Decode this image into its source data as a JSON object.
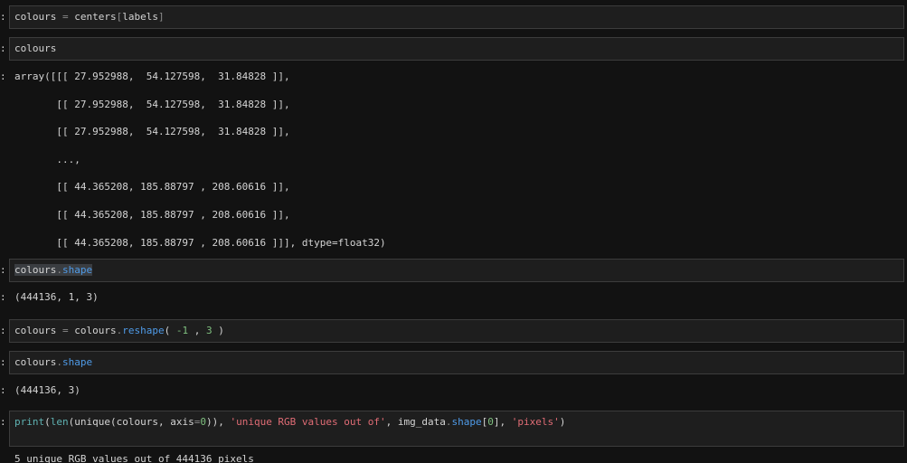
{
  "cells": [
    {
      "prompt": ":",
      "tokens": [
        {
          "t": "colours ",
          "c": "tok-kw"
        },
        {
          "t": "=",
          "c": "tok-op"
        },
        {
          "t": " centers",
          "c": "tok-kw"
        },
        {
          "t": "[",
          "c": "tok-op"
        },
        {
          "t": "labels",
          "c": "tok-kw"
        },
        {
          "t": "]",
          "c": "tok-op"
        }
      ]
    },
    {
      "prompt": ":",
      "tokens": [
        {
          "t": "colours",
          "c": "tok-kw"
        }
      ]
    },
    {
      "prompt": ":",
      "tokens": [
        {
          "t": "colours",
          "c": "tok-kw sel"
        },
        {
          "t": ".",
          "c": "tok-op sel"
        },
        {
          "t": "shape",
          "c": "tok-attr sel"
        }
      ]
    },
    {
      "prompt": ":",
      "tokens": [
        {
          "t": "colours ",
          "c": "tok-kw"
        },
        {
          "t": "=",
          "c": "tok-op"
        },
        {
          "t": " colours",
          "c": "tok-kw"
        },
        {
          "t": ".",
          "c": "tok-op"
        },
        {
          "t": "reshape",
          "c": "tok-attr"
        },
        {
          "t": "( ",
          "c": "tok-kw"
        },
        {
          "t": "-1",
          "c": "tok-num"
        },
        {
          "t": " , ",
          "c": "tok-kw"
        },
        {
          "t": "3",
          "c": "tok-num"
        },
        {
          "t": " )",
          "c": "tok-kw"
        }
      ]
    },
    {
      "prompt": ":",
      "tokens": [
        {
          "t": "colours",
          "c": "tok-kw"
        },
        {
          "t": ".",
          "c": "tok-op"
        },
        {
          "t": "shape",
          "c": "tok-attr"
        }
      ]
    },
    {
      "prompt": ":",
      "tokens": [
        {
          "t": "print",
          "c": "tok-fn"
        },
        {
          "t": "(",
          "c": "tok-kw"
        },
        {
          "t": "len",
          "c": "tok-fn"
        },
        {
          "t": "(unique(colours, axis",
          "c": "tok-kw"
        },
        {
          "t": "=",
          "c": "tok-op"
        },
        {
          "t": "0",
          "c": "tok-num"
        },
        {
          "t": ")), ",
          "c": "tok-kw"
        },
        {
          "t": "'unique RGB values out of'",
          "c": "tok-str"
        },
        {
          "t": ", img_data",
          "c": "tok-kw"
        },
        {
          "t": ".",
          "c": "tok-op"
        },
        {
          "t": "shape",
          "c": "tok-attr"
        },
        {
          "t": "[",
          "c": "tok-kw"
        },
        {
          "t": "0",
          "c": "tok-num"
        },
        {
          "t": "], ",
          "c": "tok-kw"
        },
        {
          "t": "'pixels'",
          "c": "tok-str"
        },
        {
          "t": ")",
          "c": "tok-kw"
        }
      ]
    }
  ],
  "outputs": {
    "colours_array": {
      "prompt": ":",
      "lines": [
        "array([[[ 27.952988,  54.127598,  31.84828 ]],",
        "       [[ 27.952988,  54.127598,  31.84828 ]],",
        "       [[ 27.952988,  54.127598,  31.84828 ]],",
        "       ...,",
        "       [[ 44.365208, 185.88797 , 208.60616 ]],",
        "       [[ 44.365208, 185.88797 , 208.60616 ]],",
        "       [[ 44.365208, 185.88797 , 208.60616 ]]], dtype=float32)"
      ]
    },
    "shape_before": {
      "prompt": ":",
      "text": "(444136, 1, 3)"
    },
    "shape_after": {
      "prompt": ":",
      "text": "(444136, 3)"
    },
    "print_result": {
      "text": "5 unique RGB values out of 444136 pixels"
    }
  }
}
